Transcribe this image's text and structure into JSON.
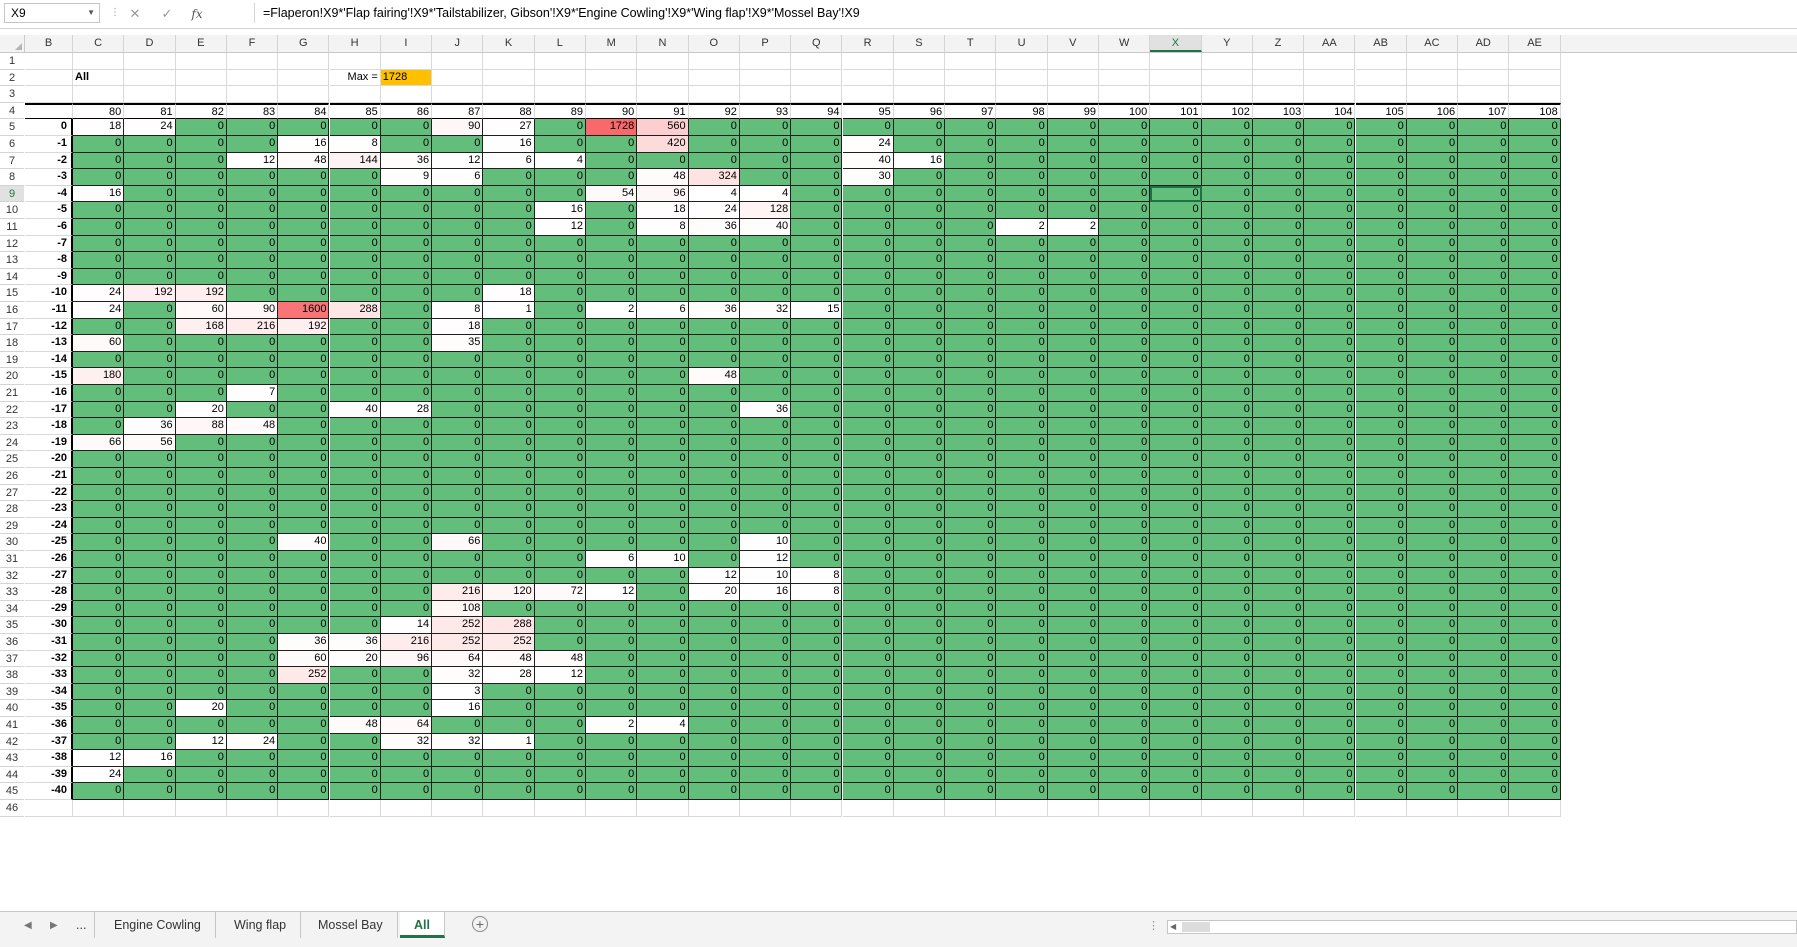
{
  "formula_bar": {
    "name_box": "X9",
    "formula": "=Flaperon!X9*'Flap fairing'!X9*'Tailstabilizer, Gibson'!X9*'Engine Cowling'!X9*'Wing flap'!X9*'Mossel Bay'!X9",
    "cancel_glyph": "✕",
    "enter_glyph": "✓",
    "fx_glyph": "fx"
  },
  "columns": [
    "B",
    "C",
    "D",
    "E",
    "F",
    "G",
    "H",
    "I",
    "J",
    "K",
    "L",
    "M",
    "N",
    "O",
    "P",
    "Q",
    "R",
    "S",
    "T",
    "U",
    "V",
    "W",
    "X",
    "Y",
    "Z",
    "AA",
    "AB",
    "AC",
    "AD",
    "AE"
  ],
  "active_column": "X",
  "rows_numbers": [
    1,
    2,
    3,
    4,
    5,
    6,
    7,
    8,
    9,
    10,
    11,
    12,
    13,
    14,
    15,
    16,
    17,
    18,
    19,
    20,
    21,
    22,
    23,
    24,
    25,
    26,
    27,
    28,
    29,
    30,
    31,
    32,
    33,
    34,
    35,
    36,
    37,
    38,
    39,
    40,
    41,
    42,
    43,
    44,
    45,
    46
  ],
  "active_row": 9,
  "summary": {
    "label": "All",
    "max_label": "Max =",
    "max_value": "1728"
  },
  "col_values": [
    "80",
    "81",
    "82",
    "83",
    "84",
    "85",
    "86",
    "87",
    "88",
    "89",
    "90",
    "91",
    "92",
    "93",
    "94",
    "95",
    "96",
    "97",
    "98",
    "99",
    "100",
    "101",
    "102",
    "103",
    "104",
    "105",
    "106",
    "107",
    "108"
  ],
  "row_labels": [
    "0",
    "-1",
    "-2",
    "-3",
    "-4",
    "-5",
    "-6",
    "-7",
    "-8",
    "-9",
    "-10",
    "-11",
    "-12",
    "-13",
    "-14",
    "-15",
    "-16",
    "-17",
    "-18",
    "-19",
    "-20",
    "-21",
    "-22",
    "-23",
    "-24",
    "-25",
    "-26",
    "-27",
    "-28",
    "-29",
    "-30",
    "-31",
    "-32",
    "-33",
    "-34",
    "-35",
    "-36",
    "-37",
    "-38",
    "-39",
    "-40"
  ],
  "nonzero": [
    [
      0,
      0,
      18
    ],
    [
      0,
      1,
      24
    ],
    [
      0,
      7,
      90
    ],
    [
      0,
      8,
      27
    ],
    [
      0,
      10,
      1728
    ],
    [
      0,
      11,
      560
    ],
    [
      1,
      4,
      16
    ],
    [
      1,
      5,
      8
    ],
    [
      1,
      8,
      16
    ],
    [
      1,
      11,
      420
    ],
    [
      1,
      15,
      24
    ],
    [
      2,
      3,
      12
    ],
    [
      2,
      4,
      48
    ],
    [
      2,
      5,
      144
    ],
    [
      2,
      6,
      36
    ],
    [
      2,
      7,
      12
    ],
    [
      2,
      8,
      6
    ],
    [
      2,
      9,
      4
    ],
    [
      2,
      15,
      40
    ],
    [
      2,
      16,
      16
    ],
    [
      3,
      6,
      9
    ],
    [
      3,
      7,
      6
    ],
    [
      3,
      11,
      48
    ],
    [
      3,
      12,
      324
    ],
    [
      3,
      15,
      30
    ],
    [
      4,
      0,
      16
    ],
    [
      4,
      10,
      54
    ],
    [
      4,
      11,
      96
    ],
    [
      4,
      12,
      4
    ],
    [
      4,
      13,
      4
    ],
    [
      5,
      9,
      16
    ],
    [
      5,
      11,
      18
    ],
    [
      5,
      12,
      24
    ],
    [
      5,
      13,
      128
    ],
    [
      6,
      9,
      12
    ],
    [
      6,
      11,
      8
    ],
    [
      6,
      12,
      36
    ],
    [
      6,
      13,
      40
    ],
    [
      6,
      18,
      2
    ],
    [
      6,
      19,
      2
    ],
    [
      10,
      0,
      24
    ],
    [
      10,
      1,
      192
    ],
    [
      10,
      2,
      192
    ],
    [
      10,
      8,
      18
    ],
    [
      11,
      0,
      24
    ],
    [
      11,
      2,
      60
    ],
    [
      11,
      3,
      90
    ],
    [
      11,
      4,
      1600
    ],
    [
      11,
      5,
      288
    ],
    [
      11,
      7,
      8
    ],
    [
      11,
      8,
      1
    ],
    [
      11,
      10,
      2
    ],
    [
      11,
      11,
      6
    ],
    [
      11,
      12,
      36
    ],
    [
      11,
      13,
      32
    ],
    [
      11,
      14,
      15
    ],
    [
      12,
      2,
      168
    ],
    [
      12,
      3,
      216
    ],
    [
      12,
      4,
      192
    ],
    [
      12,
      7,
      18
    ],
    [
      13,
      0,
      60
    ],
    [
      13,
      7,
      35
    ],
    [
      15,
      0,
      180
    ],
    [
      15,
      12,
      48
    ],
    [
      16,
      3,
      7
    ],
    [
      17,
      2,
      20
    ],
    [
      17,
      5,
      40
    ],
    [
      17,
      6,
      28
    ],
    [
      17,
      13,
      36
    ],
    [
      18,
      1,
      36
    ],
    [
      18,
      2,
      88
    ],
    [
      18,
      3,
      48
    ],
    [
      19,
      0,
      66
    ],
    [
      19,
      1,
      56
    ],
    [
      25,
      4,
      40
    ],
    [
      25,
      7,
      66
    ],
    [
      25,
      13,
      10
    ],
    [
      26,
      10,
      6
    ],
    [
      26,
      11,
      10
    ],
    [
      26,
      13,
      12
    ],
    [
      27,
      12,
      12
    ],
    [
      27,
      13,
      10
    ],
    [
      27,
      14,
      8
    ],
    [
      28,
      7,
      216
    ],
    [
      28,
      8,
      120
    ],
    [
      28,
      9,
      72
    ],
    [
      28,
      10,
      12
    ],
    [
      28,
      12,
      20
    ],
    [
      28,
      13,
      16
    ],
    [
      28,
      14,
      8
    ],
    [
      29,
      7,
      108
    ],
    [
      30,
      6,
      14
    ],
    [
      30,
      7,
      252
    ],
    [
      30,
      8,
      288
    ],
    [
      31,
      4,
      36
    ],
    [
      31,
      5,
      36
    ],
    [
      31,
      6,
      216
    ],
    [
      31,
      7,
      252
    ],
    [
      31,
      8,
      252
    ],
    [
      32,
      4,
      60
    ],
    [
      32,
      5,
      20
    ],
    [
      32,
      6,
      96
    ],
    [
      32,
      7,
      64
    ],
    [
      32,
      8,
      48
    ],
    [
      32,
      9,
      48
    ],
    [
      33,
      4,
      252
    ],
    [
      33,
      7,
      32
    ],
    [
      33,
      8,
      28
    ],
    [
      33,
      9,
      12
    ],
    [
      34,
      7,
      3
    ],
    [
      35,
      2,
      20
    ],
    [
      35,
      7,
      16
    ],
    [
      36,
      5,
      48
    ],
    [
      36,
      6,
      64
    ],
    [
      36,
      10,
      2
    ],
    [
      36,
      11,
      4
    ],
    [
      37,
      2,
      12
    ],
    [
      37,
      3,
      24
    ],
    [
      37,
      6,
      32
    ],
    [
      37,
      7,
      32
    ],
    [
      37,
      8,
      1
    ],
    [
      38,
      0,
      12
    ],
    [
      38,
      1,
      16
    ],
    [
      39,
      0,
      24
    ]
  ],
  "colors": {
    "zero_fill": "#63be7b",
    "low_fill": "#ffffff",
    "high_fill": "#f8696b",
    "max_highlight": "#ffc000",
    "excel_green": "#217346"
  },
  "tabs": {
    "more": "...",
    "items": [
      "Engine Cowling",
      "Wing flap",
      "Mossel Bay",
      "All"
    ],
    "active": "All"
  }
}
